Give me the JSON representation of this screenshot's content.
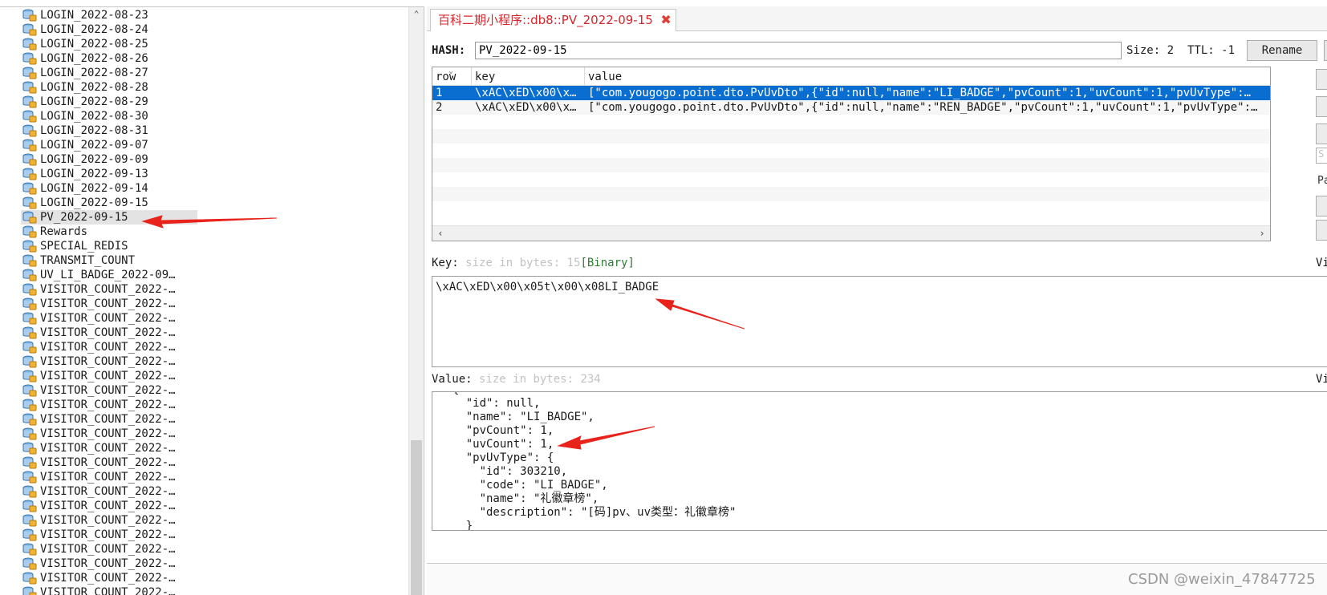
{
  "tree": {
    "items": [
      {
        "label": "LOGIN_2022-08-23"
      },
      {
        "label": "LOGIN_2022-08-24"
      },
      {
        "label": "LOGIN_2022-08-25"
      },
      {
        "label": "LOGIN_2022-08-26"
      },
      {
        "label": "LOGIN_2022-08-27"
      },
      {
        "label": "LOGIN_2022-08-28"
      },
      {
        "label": "LOGIN_2022-08-29"
      },
      {
        "label": "LOGIN_2022-08-30"
      },
      {
        "label": "LOGIN_2022-08-31"
      },
      {
        "label": "LOGIN_2022-09-07"
      },
      {
        "label": "LOGIN_2022-09-09"
      },
      {
        "label": "LOGIN_2022-09-13"
      },
      {
        "label": "LOGIN_2022-09-14"
      },
      {
        "label": "LOGIN_2022-09-15"
      },
      {
        "label": "PV_2022-09-15",
        "selected": true
      },
      {
        "label": "Rewards"
      },
      {
        "label": "SPECIAL_REDIS"
      },
      {
        "label": "TRANSMIT_COUNT"
      },
      {
        "label": "UV_LI_BADGE_2022-09…"
      },
      {
        "label": "VISITOR_COUNT_2022-…"
      },
      {
        "label": "VISITOR_COUNT_2022-…"
      },
      {
        "label": "VISITOR_COUNT_2022-…"
      },
      {
        "label": "VISITOR_COUNT_2022-…"
      },
      {
        "label": "VISITOR_COUNT_2022-…"
      },
      {
        "label": "VISITOR_COUNT_2022-…"
      },
      {
        "label": "VISITOR_COUNT_2022-…"
      },
      {
        "label": "VISITOR_COUNT_2022-…"
      },
      {
        "label": "VISITOR_COUNT_2022-…"
      },
      {
        "label": "VISITOR_COUNT_2022-…"
      },
      {
        "label": "VISITOR_COUNT_2022-…"
      },
      {
        "label": "VISITOR_COUNT_2022-…"
      },
      {
        "label": "VISITOR_COUNT_2022-…"
      },
      {
        "label": "VISITOR_COUNT_2022-…"
      },
      {
        "label": "VISITOR_COUNT_2022-…"
      },
      {
        "label": "VISITOR_COUNT_2022-…"
      },
      {
        "label": "VISITOR_COUNT_2022-…"
      },
      {
        "label": "VISITOR_COUNT_2022-…"
      },
      {
        "label": "VISITOR_COUNT_2022-…"
      },
      {
        "label": "VISITOR_COUNT_2022-…"
      },
      {
        "label": "VISITOR_COUNT_2022-…"
      },
      {
        "label": "VISITOR_COUNT_2022-…"
      }
    ],
    "scroll_up_glyph": "⌃"
  },
  "tab": {
    "title": "百科二期小程序::db8::PV_2022-09-15",
    "close_glyph": "✖"
  },
  "hash": {
    "label": "HASH:",
    "value": "PV_2022-09-15",
    "size_text": "Size: 2",
    "ttl_text": "TTL: -1",
    "rename_label": "Rename"
  },
  "grid": {
    "columns": [
      "row",
      "key",
      "value"
    ],
    "sort_glyph": "⌄",
    "rows": [
      {
        "row": "1",
        "key": "\\xAC\\xED\\x00\\x…",
        "value": "[\"com.yougogo.point.dto.PvUvDto\",{\"id\":null,\"name\":\"LI_BADGE\",\"pvCount\":1,\"uvCount\":1,\"pvUvType\":…",
        "selected": true
      },
      {
        "row": "2",
        "key": "\\xAC\\xED\\x00\\x…",
        "value": "[\"com.yougogo.point.dto.PvUvDto\",{\"id\":null,\"name\":\"REN_BADGE\",\"pvCount\":1,\"uvCount\":1,\"pvUvType\":…",
        "selected": false
      }
    ],
    "scroll_left": "‹",
    "scroll_right": "›"
  },
  "side": {
    "search_hint": "S",
    "page_hint": "Pa"
  },
  "key_section": {
    "label": "Key:",
    "size_hint": "size in bytes: 15",
    "binary_tag": "[Binary]",
    "view_label": "Vi",
    "content": "\\xAC\\xED\\x00\\x05t\\x00\\x08LI_BADGE"
  },
  "value_section": {
    "label": "Value:",
    "size_hint": "size in bytes: 234",
    "view_label": "Vi",
    "lines": [
      "  {",
      "    \"id\": null,",
      "    \"name\": \"LI_BADGE\",",
      "    \"pvCount\": 1,",
      "    \"uvCount\": 1,",
      "    \"pvUvType\": {",
      "      \"id\": 303210,",
      "      \"code\": \"LI_BADGE\",",
      "      \"name\": \"礼徽章榜\",",
      "      \"description\": \"[码]pv、uv类型：礼徽章榜\"",
      "    }"
    ]
  },
  "watermark": "CSDN @weixin_47847725",
  "colors": {
    "selection": "#0a6ed1",
    "tab_text": "#d4262b",
    "annotation_arrow": "#e8231c",
    "binary_tag": "#2e7d32"
  }
}
